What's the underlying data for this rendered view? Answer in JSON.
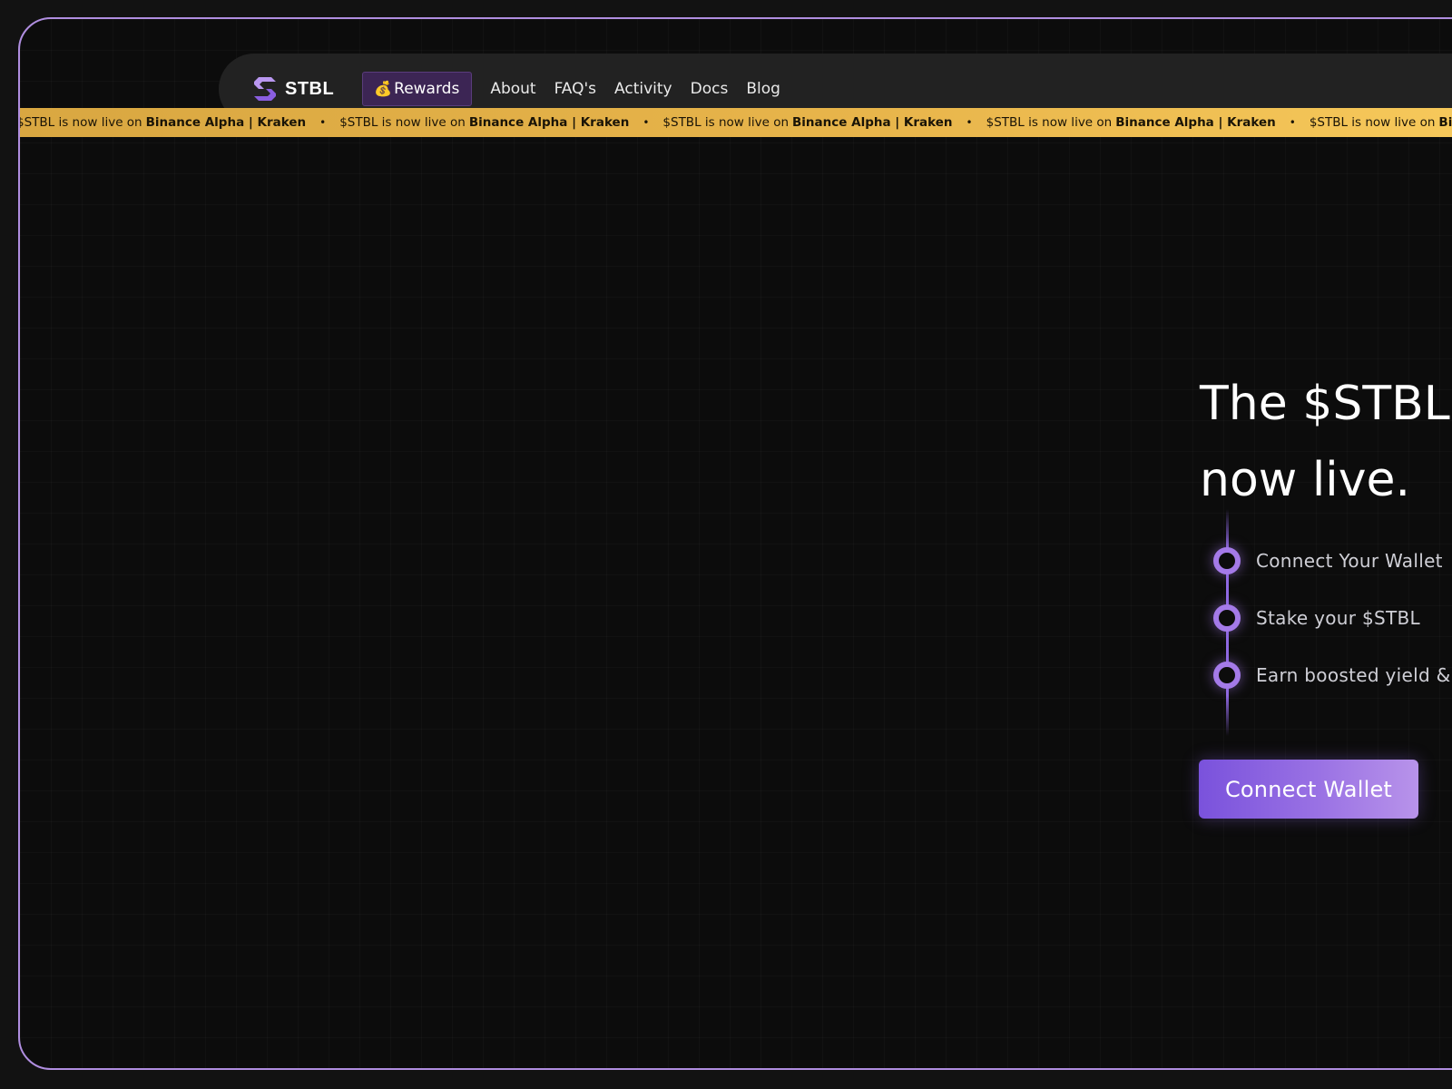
{
  "nav": {
    "logo_text": "STBL",
    "rewards_label": "Rewards",
    "links": [
      "About",
      "FAQ's",
      "Activity",
      "Docs",
      "Blog"
    ]
  },
  "ticker": {
    "prefix": "$STBL is now live on",
    "highlight": "Binance Alpha | Kraken",
    "separator": "•"
  },
  "hero": {
    "title_line1": "The $STBL",
    "title_line2": "now live.",
    "steps": [
      "Connect Your Wallet",
      "Stake your $STBL",
      "Earn boosted yield & APR"
    ],
    "cta_label": "Connect Wallet"
  },
  "colors": {
    "accent": "#8e68e2",
    "frame_border": "#b08ee0",
    "ticker_bg": "#e8b54b",
    "rewards_bg": "#3c2554",
    "nav_bg": "#222222",
    "page_bg": "#0c0c0c"
  },
  "icons": {
    "logo": "stbl-logo-icon",
    "rewards": "money-bag-icon",
    "step": "timeline-dot-icon"
  }
}
